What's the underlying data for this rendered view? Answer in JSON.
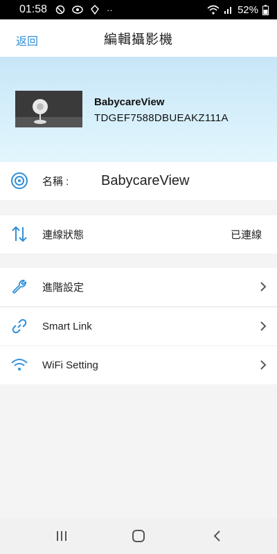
{
  "status_bar": {
    "time": "01:58",
    "notification_icons": [
      "at-icon",
      "eye-icon",
      "app-icon",
      "dots-icon"
    ],
    "dots": "··",
    "battery_percent": "52%"
  },
  "header": {
    "back_label": "返回",
    "title": "編輯攝影機"
  },
  "device": {
    "name": "BabycareView",
    "id": "TDGEF7588DBUEAKZ111A"
  },
  "rows": {
    "name": {
      "label": "名稱 :",
      "value": "BabycareView",
      "icon": "camera-lens-icon"
    },
    "connection": {
      "label": "連線狀態",
      "value": "已連線",
      "icon": "up-down-arrows-icon"
    },
    "advanced": {
      "label": "進階設定",
      "icon": "wrench-icon"
    },
    "smart_link": {
      "label": "Smart Link",
      "icon": "link-icon"
    },
    "wifi": {
      "label": "WiFi Setting",
      "icon": "wifi-icon"
    }
  },
  "colors": {
    "accent": "#2f8fd8",
    "hero_top": "#c8e6f8",
    "hero_bottom": "#e3f6fd",
    "background": "#f4f4f4"
  },
  "system_nav": {
    "icons": [
      "recent-apps-icon",
      "home-icon",
      "back-icon"
    ]
  }
}
